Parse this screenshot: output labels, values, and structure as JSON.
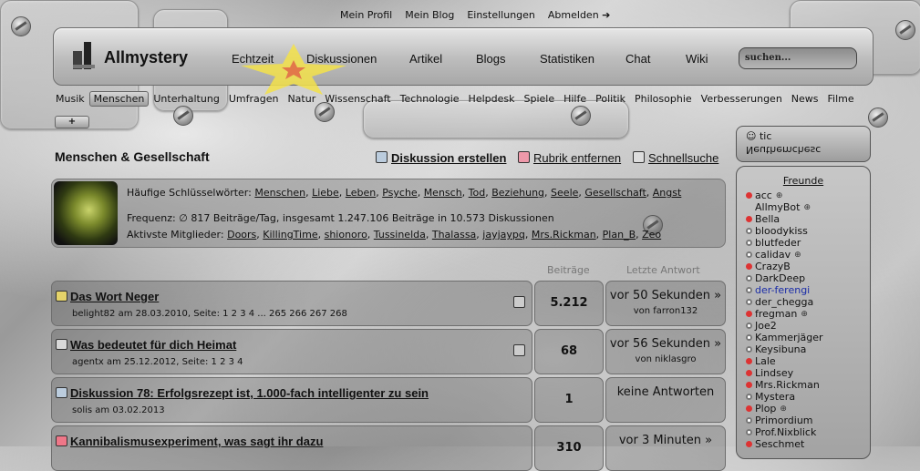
{
  "toplinks": [
    "Mein Profil",
    "Mein Blog",
    "Einstellungen",
    "Abmelden ➔"
  ],
  "brand": "Allmystery",
  "mainnav": [
    "Echtzeit",
    "Diskussionen",
    "Artikel",
    "Blogs",
    "Statistiken",
    "Chat",
    "Wiki"
  ],
  "search": {
    "placeholder": "suchen..."
  },
  "categories": [
    "Musik",
    "Menschen",
    "Unterhaltung",
    "Umfragen",
    "Natur",
    "Wissenschaft",
    "Technologie",
    "Helpdesk",
    "Spiele",
    "Hilfe",
    "Politik",
    "Philosophie",
    "Verbesserungen",
    "News",
    "Filme"
  ],
  "active_category": "Menschen",
  "plus_label": "+",
  "section_title": "Menschen & Gesellschaft",
  "actions": {
    "create": "Diskussion erstellen",
    "remove": "Rubrik entfernen",
    "quicksearch": "Schnellsuche"
  },
  "info": {
    "keywords_label": "Häufige Schlüsselwörter:",
    "keywords": [
      "Menschen",
      "Liebe",
      "Leben",
      "Psyche",
      "Mensch",
      "Tod",
      "Beziehung",
      "Seele",
      "Gesellschaft",
      "Angst"
    ],
    "frequency": "Frequenz: ∅ 817 Beiträge/Tag, insgesamt 1.247.106 Beiträge in 10.573 Diskussionen",
    "members_label": "Aktivste Mitglieder:",
    "members": [
      "Doors",
      "KillingTime",
      "shionoro",
      "Tussinelda",
      "Thalassa",
      "jayjaypq",
      "Mrs.Rickman",
      "Plan_B",
      "Zeo"
    ]
  },
  "colheads": {
    "count": "Beiträge",
    "last": "Letzte Antwort"
  },
  "discussions": [
    {
      "title": "Das Wort Neger",
      "meta": "belight82 am 28.03.2010, Seite: 1 2 3 4 ... 265 266 267 268",
      "count": "5.212",
      "last": "vor 50 Sekunden »",
      "by": "von farron132",
      "pinned": true
    },
    {
      "title": "Was bedeutet für dich Heimat",
      "meta": "agentx am 25.12.2012, Seite: 1 2 3 4",
      "count": "68",
      "last": "vor 56 Sekunden »",
      "by": "von niklasgro",
      "pinned": true
    },
    {
      "title": "Diskussion 78: Erfolgsrezept ist, 1.000-fach intelligenter zu sein",
      "meta": "solis am 03.02.2013",
      "count": "1",
      "last": "keine Antworten",
      "by": "",
      "pinned": false
    },
    {
      "title": "Kannibalismusexperiment, was sagt ihr dazu",
      "meta": "",
      "count": "310",
      "last": "vor 3 Minuten »",
      "by": "",
      "pinned": false
    }
  ],
  "sidebar_top": [
    "tic",
    "Neuthemchesc"
  ],
  "friends_heading": "Freunde",
  "friends": [
    {
      "name": "acc",
      "status": "dnd",
      "x": true
    },
    {
      "name": "AllmyBot",
      "status": "none",
      "x": true
    },
    {
      "name": "Bella",
      "status": "dnd",
      "x": false
    },
    {
      "name": "bloodykiss",
      "status": "on",
      "x": false
    },
    {
      "name": "blutfeder",
      "status": "on",
      "x": false
    },
    {
      "name": "calidav",
      "status": "on",
      "x": true
    },
    {
      "name": "CrazyB",
      "status": "dnd",
      "x": false
    },
    {
      "name": "DarkDeep",
      "status": "on",
      "x": false
    },
    {
      "name": "der-ferengi",
      "status": "on",
      "x": false
    },
    {
      "name": "der_chegga",
      "status": "on",
      "x": false
    },
    {
      "name": "fregman",
      "status": "dnd",
      "x": true
    },
    {
      "name": "Joe2",
      "status": "on",
      "x": false
    },
    {
      "name": "Kammerjäger",
      "status": "on",
      "x": false
    },
    {
      "name": "Keysibuna",
      "status": "on",
      "x": false
    },
    {
      "name": "Lale",
      "status": "dnd",
      "x": false
    },
    {
      "name": "Lindsey",
      "status": "dnd",
      "x": false
    },
    {
      "name": "Mrs.Rickman",
      "status": "dnd",
      "x": false
    },
    {
      "name": "Mystera",
      "status": "on",
      "x": false
    },
    {
      "name": "Plop",
      "status": "dnd",
      "x": true
    },
    {
      "name": "Primordium",
      "status": "on",
      "x": false
    },
    {
      "name": "Prof.Nixblick",
      "status": "on",
      "x": false
    },
    {
      "name": "Seschmet",
      "status": "dnd",
      "x": false
    }
  ]
}
